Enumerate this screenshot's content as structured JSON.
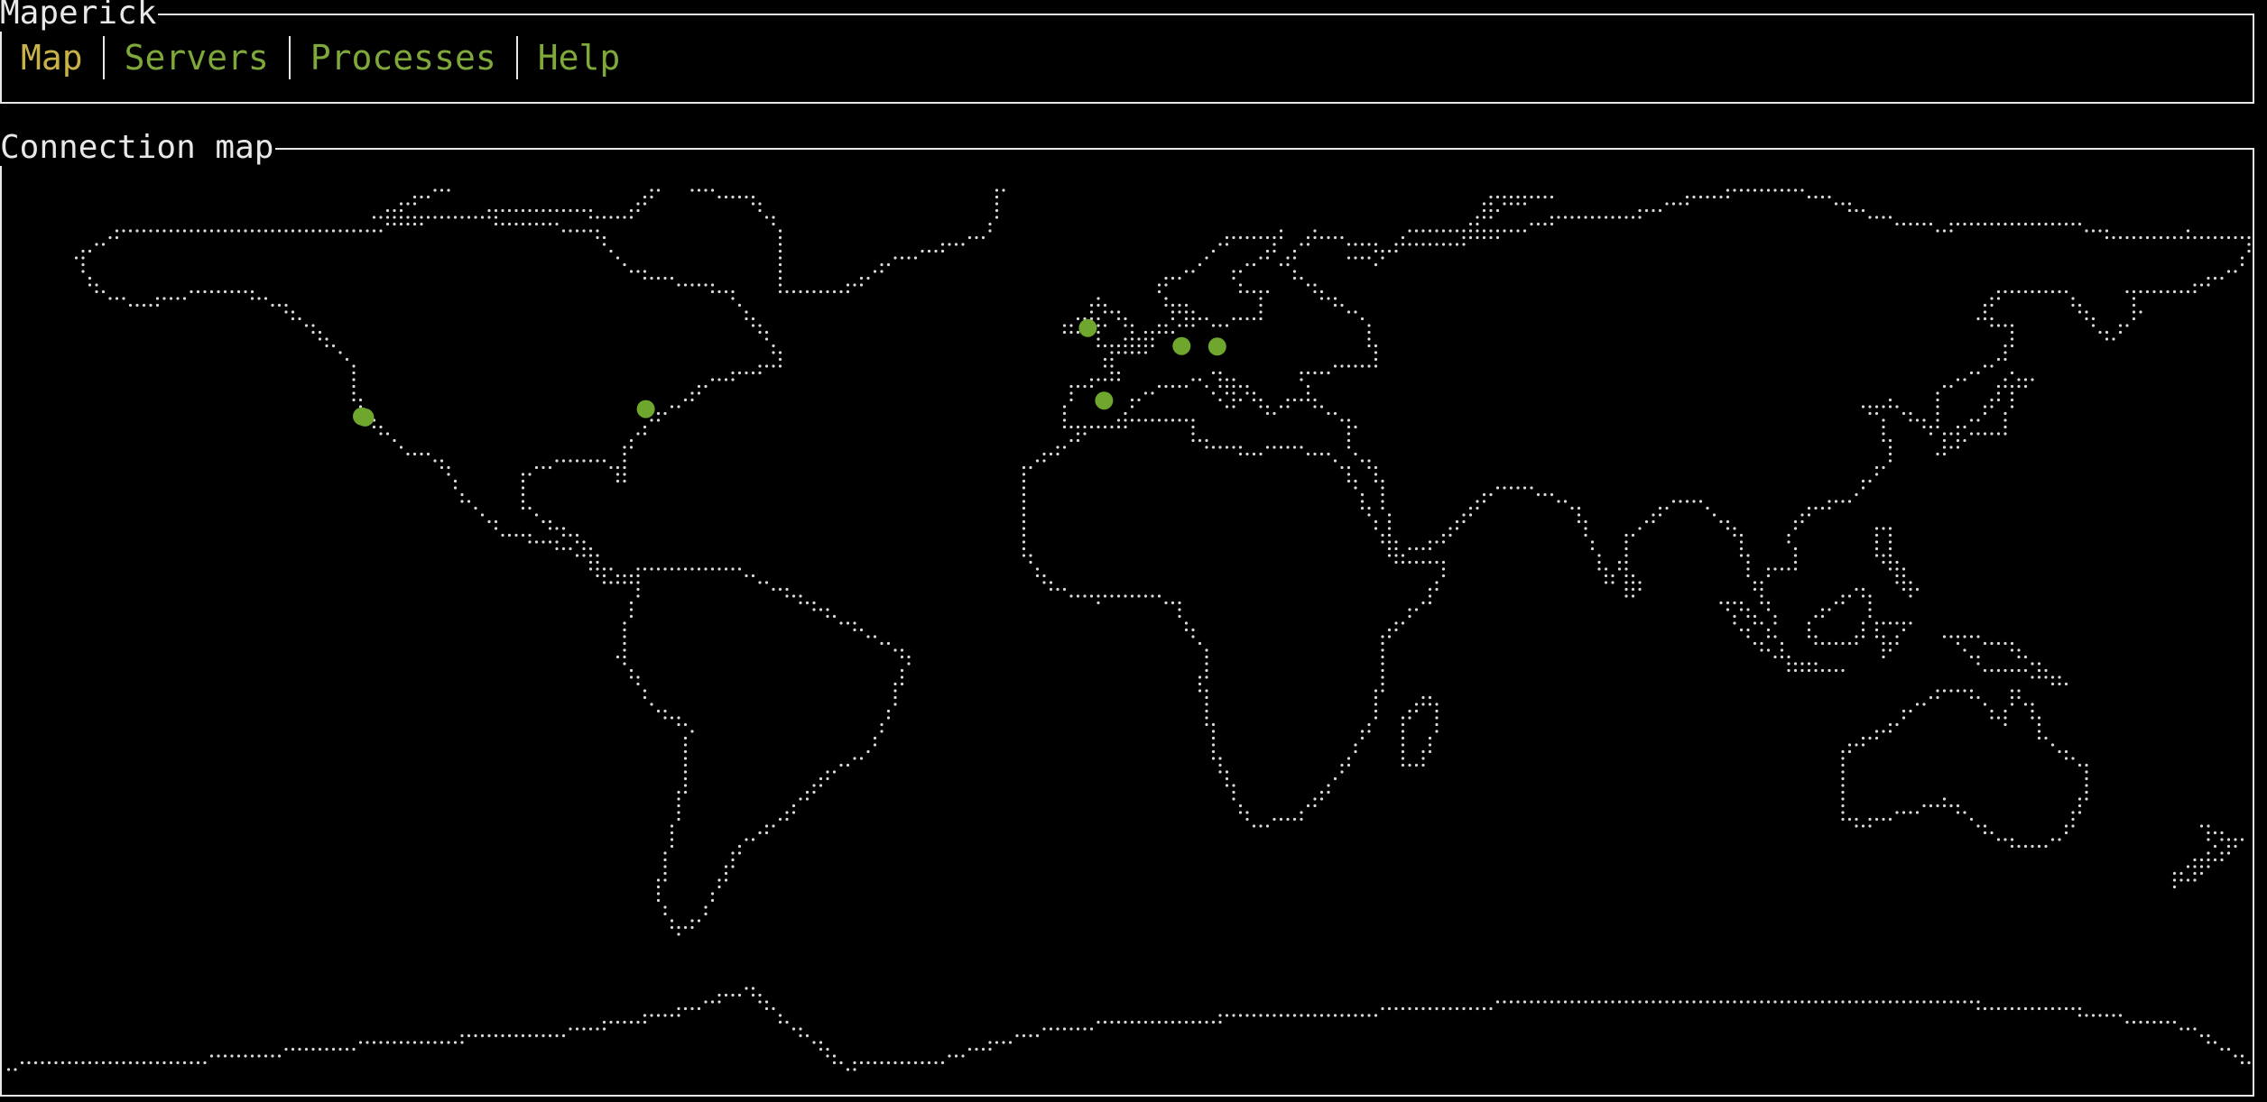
{
  "app": {
    "title": "Maperick"
  },
  "tabs": [
    {
      "label": "Map",
      "active": true
    },
    {
      "label": "Servers",
      "active": false
    },
    {
      "label": "Processes",
      "active": false
    },
    {
      "label": "Help",
      "active": false
    }
  ],
  "map_panel": {
    "title": "Connection map"
  },
  "colors": {
    "background": "#000000",
    "border": "#e8e8e8",
    "tab_inactive": "#7fa83a",
    "tab_active": "#c9b14a",
    "connection_marker": "#6fa62e",
    "map_dots": "#d8d8d8"
  },
  "icons": {
    "connection_marker": "filled-circle"
  },
  "connections": [
    {
      "lat": 37.6,
      "lon": -122.4
    },
    {
      "lat": 37.4,
      "lon": -121.9
    },
    {
      "lat": 38.9,
      "lon": -77.0
    },
    {
      "lat": 53.3,
      "lon": -6.3
    },
    {
      "lat": 50.1,
      "lon": 8.7
    },
    {
      "lat": 50.0,
      "lon": 14.4
    },
    {
      "lat": 40.4,
      "lon": -3.7
    }
  ]
}
